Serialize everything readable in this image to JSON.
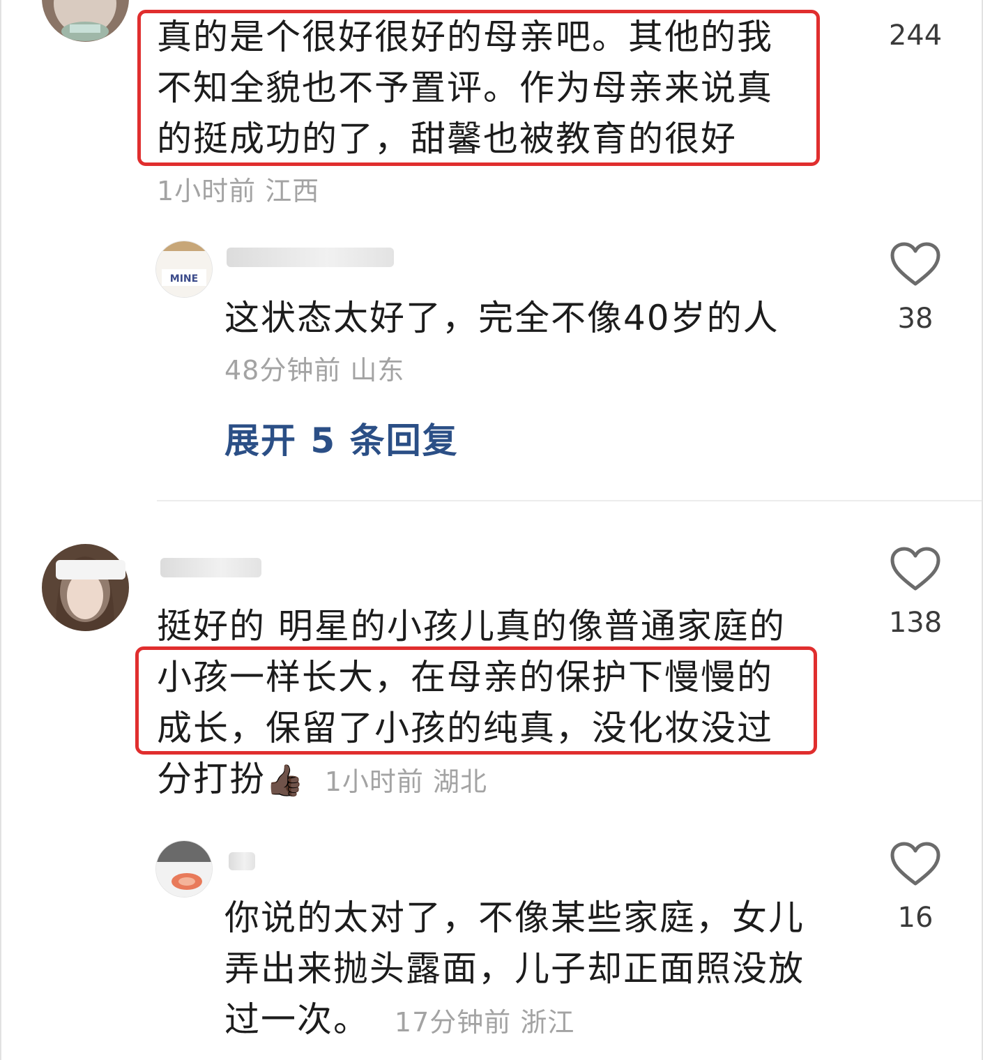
{
  "comments": [
    {
      "text_lines": [
        "真的是个很好很好的母亲吧。其他的我",
        "不知全貌也不予置评。作为母亲来说真",
        "的挺成功的了，甜馨也被教育的很好"
      ],
      "meta": "1小时前  江西",
      "likes": "244"
    },
    {
      "reply_text": "这状态太好了，完全不像40岁的人",
      "meta": "48分钟前  山东",
      "likes": "38",
      "avatar_text": "MINE"
    },
    {
      "expand_label": "展开 5 条回复"
    },
    {
      "text_lines": [
        "挺好的 明星的小孩儿真的像普通家庭的",
        "小孩一样长大，在母亲的保护下慢慢的",
        "成长，保留了小孩的纯真，没化妆没过",
        "分打扮"
      ],
      "emoji": "👍🏿",
      "meta": "1小时前  湖北",
      "likes": "138"
    },
    {
      "text_lines": [
        "你说的太对了，不像某些家庭，女儿",
        "弄出来抛头露面，儿子却正面照没放",
        "过一次。"
      ],
      "meta": "17分钟前  浙江",
      "likes": "16"
    }
  ],
  "colors": {
    "highlight": "#e02e2e",
    "expand": "#2b4f86",
    "meta": "#a3a3a3"
  },
  "icons": [
    "heart-icon",
    "thumbs-up-icon"
  ]
}
